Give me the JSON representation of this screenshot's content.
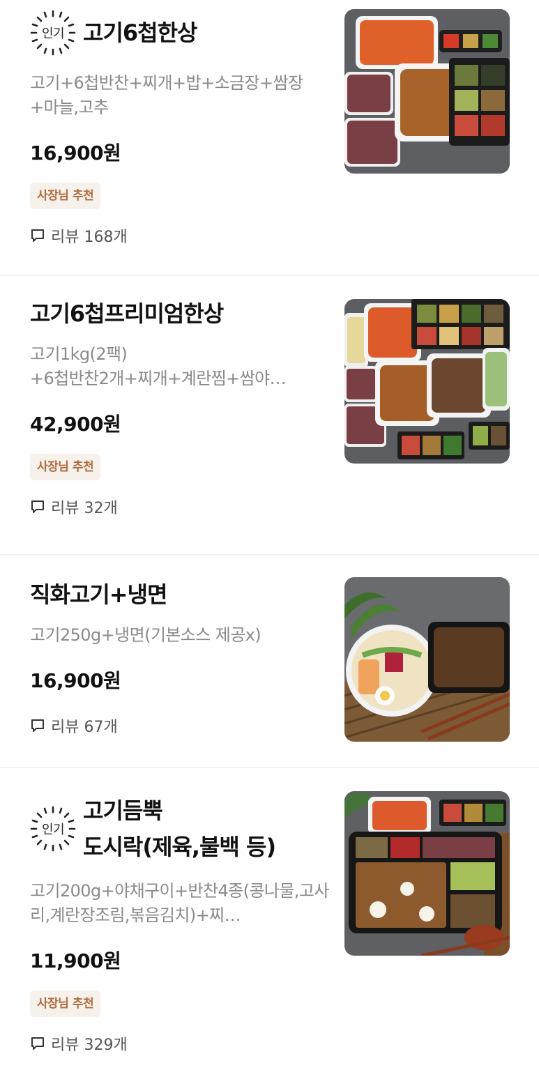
{
  "menu": {
    "items": [
      {
        "popular_label": "인기",
        "title": "고기6첩한상",
        "desc": "고기+6첩반찬+찌개+밥+소금장+쌈장+마늘,고추",
        "price": "16,900원",
        "tag": "사장님 추천",
        "review": "리뷰 168개"
      },
      {
        "title": "고기6첩프리미엄한상",
        "desc": "고기1kg(2팩)\n+6첩반찬2개+찌개+계란찜+쌈야…",
        "price": "42,900원",
        "tag": "사장님 추천",
        "review": "리뷰 32개"
      },
      {
        "title": "직화고기+냉면",
        "desc": "고기250g+냉면(기본소스 제공x)",
        "price": "16,900원",
        "review": "리뷰 67개"
      },
      {
        "popular_label": "인기",
        "title_line1": "고기듬뿍",
        "title_line2": "도시락(제육,불백 등)",
        "desc": "고기200g+야채구이+반찬4종(콩나물,고사리,계란장조림,볶음김치)+찌…",
        "price": "11,900원",
        "tag": "사장님 추천",
        "review": "리뷰 329개"
      }
    ]
  },
  "icons": {
    "review": "speech-bubble-icon",
    "popular": "sunburst-badge-icon"
  },
  "colors": {
    "tag_bg": "#f7f1ec",
    "tag_text": "#b06a3b",
    "desc": "#8a8a8a",
    "divider": "#f2f2f2"
  }
}
